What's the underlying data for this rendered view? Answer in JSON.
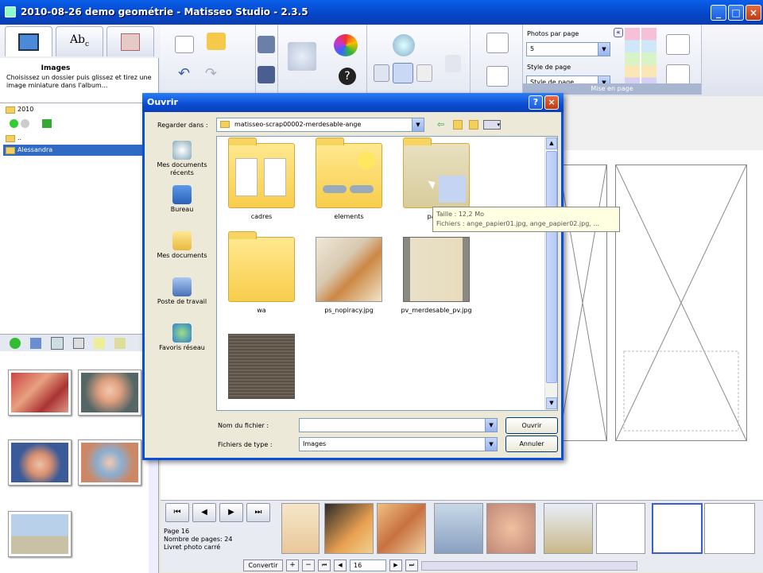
{
  "window": {
    "title": "2010-08-26 demo geométrie - Matisseo Studio - 2.3.5"
  },
  "ribbon": {
    "photos_par_page_label": "Photos par page",
    "photos_par_page_value": "5",
    "style_label": "Style de page",
    "style_value": "Style de page",
    "group_label": "Mise en page"
  },
  "left": {
    "title": "Images",
    "desc": "Choisissez un dossier puis glissez et tirez une image miniature dans l'album...",
    "tree": [
      "2010",
      "",
      "..",
      "Alessandra"
    ]
  },
  "bottom": {
    "page": "Page 16",
    "count": "Nombre de pages: 24",
    "type": "Livret photo carré",
    "convert": "Convertir",
    "page_input": "16"
  },
  "dialog": {
    "title": "Ouvrir",
    "look_in_label": "Regarder dans :",
    "look_in_value": "matisseo-scrap00002-merdesable-ange",
    "places": [
      "Mes documents récents",
      "Bureau",
      "Mes documents",
      "Poste de travail",
      "Favoris réseau"
    ],
    "files": [
      "cadres",
      "elements",
      "pap...",
      "wa",
      "ps_nopiracy.jpg",
      "pv_merdesable_pv.jpg",
      ""
    ],
    "tooltip_size": "Taille : 12,2 Mo",
    "tooltip_files": "Fichiers : ange_papier01.jpg, ange_papier02.jpg, ...",
    "filename_label": "Nom du fichier :",
    "filename_value": "",
    "filetype_label": "Fichiers de type :",
    "filetype_value": "Images",
    "open_label": "Ouvrir",
    "cancel_label": "Annuler"
  }
}
